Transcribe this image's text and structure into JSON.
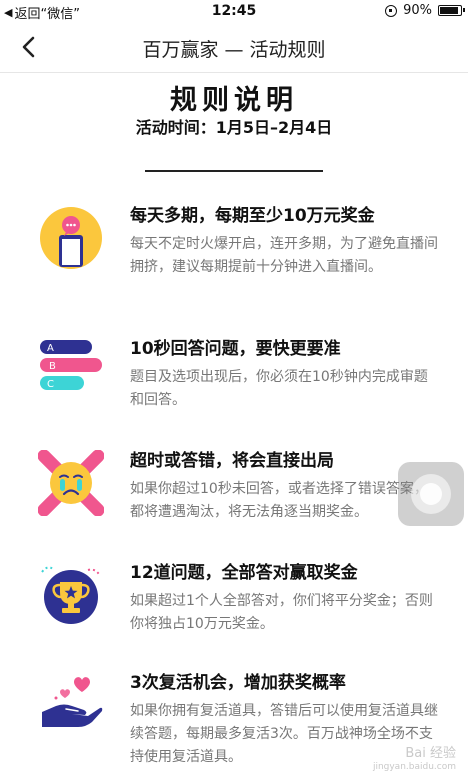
{
  "status_bar": {
    "back_label": "返回“微信”",
    "time": "12:45",
    "battery": "90%"
  },
  "nav": {
    "title": "百万赢家 — 活动规则"
  },
  "heading": "规则说明",
  "activity_time": "活动时间：1月5日–2月4日",
  "rules": [
    {
      "icon": "phone-chat-icon",
      "title": "每天多期，每期至少10万元奖金",
      "desc": "每天不定时火爆开启，连开多期，为了避免直播间拥挤，建议每期提前十分钟进入直播间。"
    },
    {
      "icon": "abc-options-icon",
      "title": "10秒回答问题，要快更要准",
      "desc": "题目及选项出现后，你必须在10秒钟内完成审题和回答。"
    },
    {
      "icon": "crying-face-x-icon",
      "title": "超时或答错，将会直接出局",
      "desc": "如果你超过10秒未回答，或者选择了错误答案，都将遭遇淘汰，将无法角逐当期奖金。"
    },
    {
      "icon": "trophy-icon",
      "title": "12道问题，全部答对赢取奖金",
      "desc": "如果超过1个人全部答对，你们将平分奖金；否则你将独占10万元奖金。"
    },
    {
      "icon": "hand-hearts-icon",
      "title": "3次复活机会，增加获奖概率",
      "desc": "如果你拥有复活道具，答错后可以使用复活道具继续答题，每期最多复活3次。百万战神场全场不支持使用复活道具。"
    }
  ],
  "option_labels": [
    "A",
    "B",
    "C"
  ],
  "colors": {
    "yellow": "#FBC73D",
    "navy": "#2E3192",
    "pink": "#F0568E",
    "cyan": "#3DD4D6",
    "purple": "#5D3FD3"
  },
  "watermark": {
    "main": "Bai 经验",
    "sub": "jingyan.baidu.com"
  }
}
